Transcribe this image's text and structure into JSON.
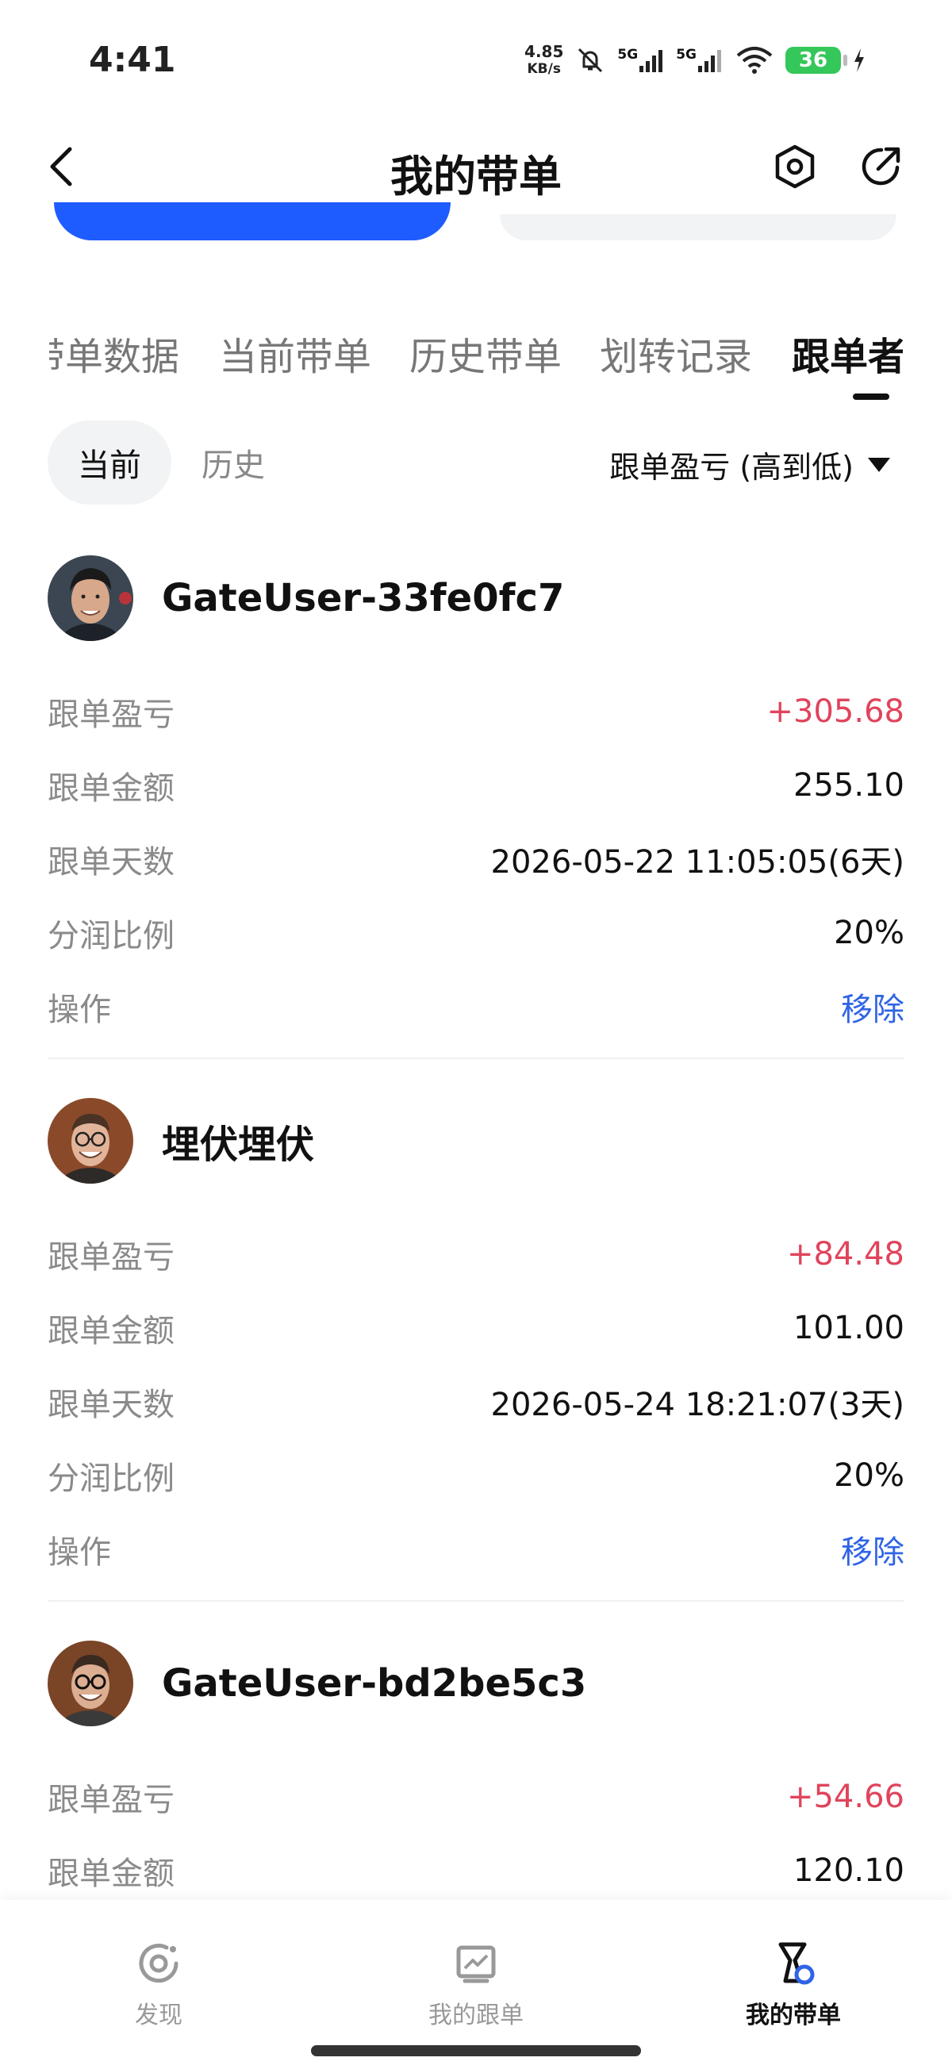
{
  "status_bar": {
    "time": "4:41",
    "net_speed_value": "4.85",
    "net_speed_unit": "KB/s",
    "signal_1": "5G",
    "signal_2": "5G",
    "battery": "36"
  },
  "header": {
    "title": "我的带单",
    "back_icon": "chevron-left-icon",
    "settings_icon": "hexagon-settings-icon",
    "share_icon": "share-icon"
  },
  "tabs": [
    {
      "label": "带单数据",
      "active": false
    },
    {
      "label": "当前带单",
      "active": false
    },
    {
      "label": "历史带单",
      "active": false
    },
    {
      "label": "划转记录",
      "active": false
    },
    {
      "label": "跟单者",
      "active": true
    }
  ],
  "filter": {
    "current": "当前",
    "history": "历史",
    "sort_label": "跟单盈亏 (高到低)"
  },
  "followers": [
    {
      "name": "GateUser-33fe0fc7",
      "rows": [
        {
          "label": "跟单盈亏",
          "value": "+305.68",
          "type": "pos"
        },
        {
          "label": "跟单金额",
          "value": "255.10",
          "type": "normal"
        },
        {
          "label": "跟单天数",
          "value": "2026-05-22 11:05:05(6天)",
          "type": "normal"
        },
        {
          "label": "分润比例",
          "value": "20%",
          "type": "normal"
        },
        {
          "label": "操作",
          "value": "移除",
          "type": "link"
        }
      ]
    },
    {
      "name": "埋伏埋伏",
      "rows": [
        {
          "label": "跟单盈亏",
          "value": "+84.48",
          "type": "pos"
        },
        {
          "label": "跟单金额",
          "value": "101.00",
          "type": "normal"
        },
        {
          "label": "跟单天数",
          "value": "2026-05-24 18:21:07(3天)",
          "type": "normal"
        },
        {
          "label": "分润比例",
          "value": "20%",
          "type": "normal"
        },
        {
          "label": "操作",
          "value": "移除",
          "type": "link"
        }
      ]
    },
    {
      "name": "GateUser-bd2be5c3",
      "rows": [
        {
          "label": "跟单盈亏",
          "value": "+54.66",
          "type": "pos"
        },
        {
          "label": "跟单金额",
          "value": "120.10",
          "type": "normal"
        }
      ]
    }
  ],
  "bottom_nav": [
    {
      "label": "发现",
      "icon": "discover-icon",
      "active": false
    },
    {
      "label": "我的跟单",
      "icon": "chart-icon",
      "active": false
    },
    {
      "label": "我的带单",
      "icon": "lead-trader-icon",
      "active": true
    }
  ],
  "colors": {
    "accent_blue": "#1f5cff",
    "profit_red": "#e0445c",
    "link_blue": "#2f64e6"
  }
}
